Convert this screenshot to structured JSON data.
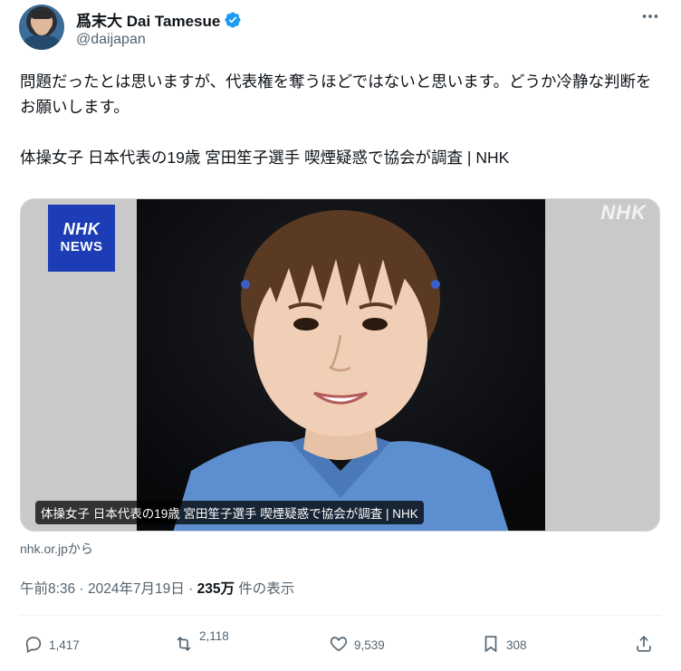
{
  "author": {
    "display_name": "爲末大 Dai Tamesue",
    "handle": "@daijapan",
    "verified": true,
    "verified_color": "#1d9bf0"
  },
  "tweet": {
    "text": "問題だったとは思いますが、代表権を奪うほどではないと思います。どうか冷静な判断をお願いします。\n\n体操女子 日本代表の19歳 宮田笙子選手 喫煙疑惑で協会が調査 | NHK"
  },
  "card": {
    "logo_line1": "NHK",
    "logo_line2": "NEWS",
    "watermark": "NHK",
    "caption": "体操女子 日本代表の19歳 宮田笙子選手 喫煙疑惑で協会が調査 | NHK",
    "domain": "nhk.or.jpから"
  },
  "meta": {
    "time": "午前8:36",
    "date": "2024年7月19日",
    "views": "235万",
    "views_suffix": "件の表示"
  },
  "actions": {
    "replies": "1,417",
    "reposts": "2,118",
    "likes": "9,539",
    "bookmarks": "308"
  },
  "icons": {
    "more": "more-dots-icon",
    "reply": "reply-icon",
    "repost": "repost-icon",
    "like": "heart-icon",
    "bookmark": "bookmark-icon",
    "share": "share-icon"
  }
}
